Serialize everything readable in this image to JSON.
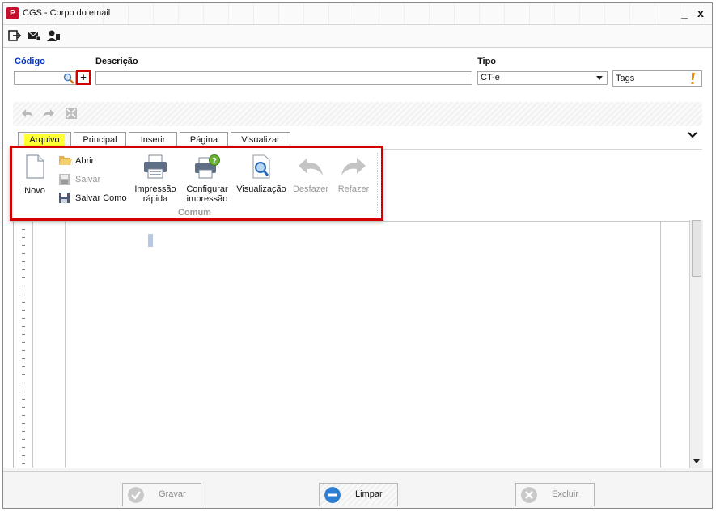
{
  "window": {
    "title": "CGS - Corpo do email",
    "minimize": "_",
    "close": "x"
  },
  "form": {
    "codigo_label": "Código",
    "descricao_label": "Descrição",
    "tipo_label": "Tipo",
    "codigo_value": "",
    "descricao_value": "",
    "tipo_value": "CT-e",
    "tags_label": "Tags",
    "plus_label": "+"
  },
  "tabs": [
    {
      "label": "Arquivo",
      "active": true
    },
    {
      "label": "Principal"
    },
    {
      "label": "Inserir"
    },
    {
      "label": "Página"
    },
    {
      "label": "Visualizar"
    }
  ],
  "ribbon": {
    "novo": "Novo",
    "abrir": "Abrir",
    "salvar": "Salvar",
    "salvar_como": "Salvar Como",
    "impressao_rapida_1": "Impressão",
    "impressao_rapida_2": "rápida",
    "configurar_1": "Configurar",
    "configurar_2": "impressão",
    "visualizacao": "Visualização",
    "desfazer": "Desfazer",
    "refazer": "Refazer",
    "group_label": "Comum"
  },
  "bottom": {
    "gravar": "Gravar",
    "limpar": "Limpar",
    "excluir": "Excluir"
  },
  "colors": {
    "accent_red": "#d40000",
    "highlight": "#ffff33",
    "codigo_blue": "#0033cc"
  }
}
